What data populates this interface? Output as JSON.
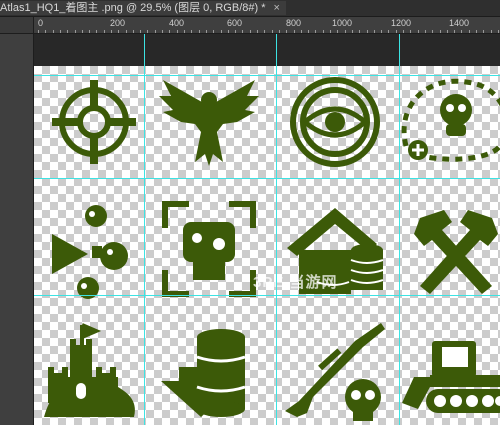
{
  "document_tab": {
    "title": "Atlas1_HQ1_着图主 .png @ 29.5% (图层 0, RGB/8#) *",
    "close_symbol": "×"
  },
  "ruler": {
    "horizontal_labels": [
      "0",
      "200",
      "400",
      "600",
      "800",
      "1000",
      "1200",
      "1400"
    ]
  },
  "watermark": {
    "text": "3PE 当游网"
  },
  "icons": [
    "crosshair-icon",
    "eagle-icon",
    "eye-icon",
    "gasmask-path-icon",
    "zombie-heads-arrow-icon",
    "zombie-target-icon",
    "house-coins-icon",
    "crossed-hammers-icon",
    "castle-icon",
    "barrel-down-arrow-icon",
    "rifle-skull-icon",
    "bulldozer-icon"
  ],
  "colors": {
    "icon_fill": "#3c5a08",
    "guide_line": "#3de3e3",
    "workspace": "#282828"
  }
}
